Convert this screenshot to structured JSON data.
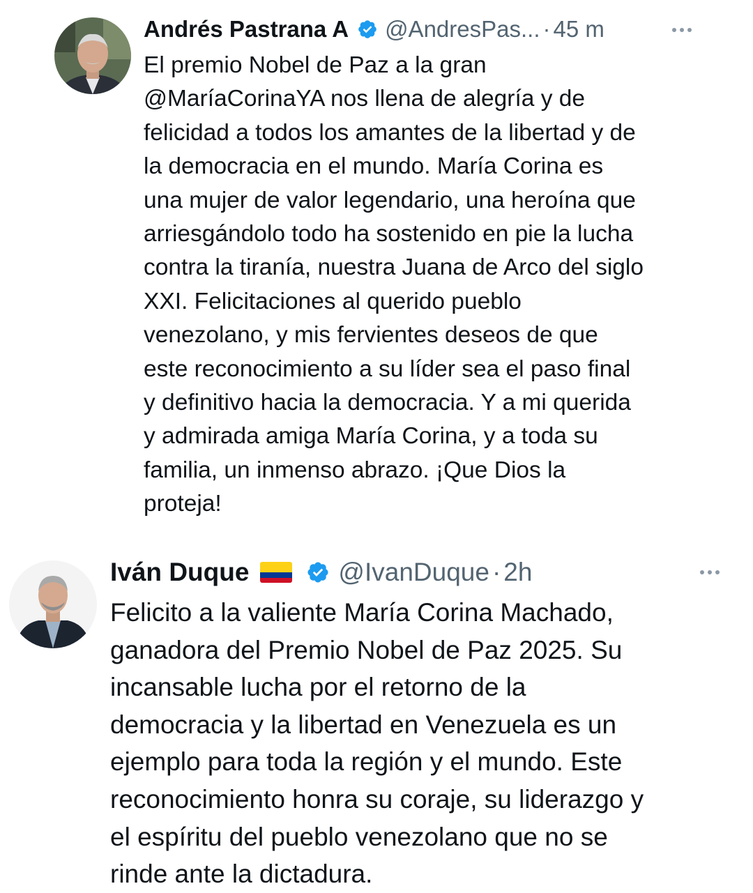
{
  "tweets": [
    {
      "author_name": "Andrés Pastrana A",
      "handle": "@AndresPas...",
      "separator": "·",
      "timestamp": "45 m",
      "verified": true,
      "text_mention": "@MaríaCorinaYA",
      "text_before": "El premio Nobel de Paz a la gran\n",
      "text_after": " nos llena de alegría y de\nfelicidad a todos los amantes de la libertad y de\nla democracia en el mundo. María Corina es\nuna mujer de valor legendario, una heroína que\narriesgándolo todo ha sostenido en pie la lucha\ncontra la tiranía, nuestra Juana de Arco del siglo\nXXI. Felicitaciones al querido pueblo\nvenezolano, y mis fervientes deseos de que\neste reconocimiento a su líder sea el paso final\ny definitivo hacia la democracia. Y a mi querida\ny admirada amiga María Corina, y a toda su\nfamilia, un inmenso abrazo. ¡Que Dios la\nproteja!"
    },
    {
      "author_name": "Iván Duque",
      "flag_icon": "colombia-flag-icon",
      "handle": "@IvanDuque",
      "separator": "·",
      "timestamp": "2h",
      "verified": true,
      "text": "Felicito a la valiente María Corina Machado,\nganadora del Premio Nobel de Paz 2025. Su\nincansable lucha por el retorno de la\ndemocracia y la libertad en Venezuela es un\nejemplo para toda la región y el mundo. Este\nreconocimiento honra su coraje, su liderazgo y\nel espíritu del pueblo venezolano que no se\nrinde ante la dictadura."
    }
  ],
  "colors": {
    "verified": "#1d9bf0",
    "secondary_text": "#536471",
    "primary_text": "#0f1419",
    "flag_yellow": "#fcd116",
    "flag_blue": "#003893",
    "flag_red": "#ce1126"
  },
  "icons": {
    "verified": "verified-badge-icon",
    "more": "more-options-icon"
  }
}
